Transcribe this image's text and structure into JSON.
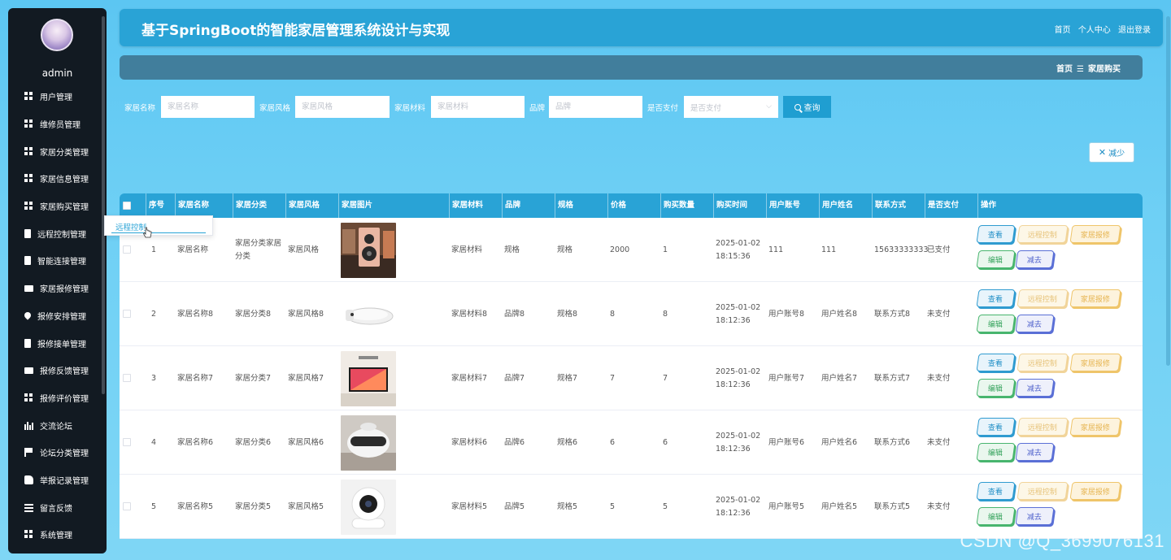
{
  "sidebar": {
    "username": "admin",
    "items": [
      {
        "label": "用户管理",
        "icon": "grid-icon"
      },
      {
        "label": "维修员管理",
        "icon": "grid-icon"
      },
      {
        "label": "家居分类管理",
        "icon": "grid-icon"
      },
      {
        "label": "家居信息管理",
        "icon": "grid-icon"
      },
      {
        "label": "家居购买管理",
        "icon": "grid-icon"
      },
      {
        "label": "远程控制管理",
        "icon": "clipboard-icon"
      },
      {
        "label": "智能连接管理",
        "icon": "clipboard-icon"
      },
      {
        "label": "家居报修管理",
        "icon": "monitor-icon"
      },
      {
        "label": "报修安排管理",
        "icon": "pin-icon"
      },
      {
        "label": "报修接单管理",
        "icon": "clipboard-icon"
      },
      {
        "label": "报修反馈管理",
        "icon": "monitor-icon"
      },
      {
        "label": "报修评价管理",
        "icon": "grid-icon"
      },
      {
        "label": "交流论坛",
        "icon": "chart-icon"
      },
      {
        "label": "论坛分类管理",
        "icon": "flag-icon"
      },
      {
        "label": "举报记录管理",
        "icon": "hand-icon"
      },
      {
        "label": "留言反馈",
        "icon": "lines-icon"
      },
      {
        "label": "系统管理",
        "icon": "grid-icon"
      }
    ]
  },
  "header": {
    "title": "基于SpringBoot的智能家居管理系统设计与实现",
    "links": [
      "首页",
      "个人中心",
      "退出登录"
    ]
  },
  "breadcrumb": {
    "home": "首页",
    "separator": "☰",
    "current": "家居购买"
  },
  "search": {
    "fields": [
      {
        "label": "家居名称",
        "placeholder": "家居名称"
      },
      {
        "label": "家居风格",
        "placeholder": "家居风格"
      },
      {
        "label": "家居材料",
        "placeholder": "家居材料"
      },
      {
        "label": "品牌",
        "placeholder": "品牌"
      }
    ],
    "paid_label": "是否支付",
    "paid_placeholder": "是否支付",
    "button": "查询"
  },
  "reduce_button": "减少",
  "popup": {
    "text": "远程控制"
  },
  "table": {
    "headers": [
      "序号",
      "家居名称",
      "家居分类",
      "家居风格",
      "家居图片",
      "家居材料",
      "品牌",
      "规格",
      "价格",
      "购买数量",
      "购买时间",
      "用户账号",
      "用户姓名",
      "联系方式",
      "是否支付",
      "操作"
    ],
    "rows": [
      {
        "idx": "1",
        "name": "家居名称",
        "category": "家居分类家居分类",
        "style": "家居风格",
        "material": "家居材料",
        "brand": "规格",
        "spec": "规格",
        "price": "2000",
        "qty": "1",
        "time": "2025-01-02 18:15:36",
        "account": "111",
        "uname": "111",
        "contact": "15633333333",
        "paid": "已支付",
        "image": "speaker-icon"
      },
      {
        "idx": "2",
        "name": "家居名称8",
        "category": "家居分类8",
        "style": "家居风格8",
        "material": "家居材料8",
        "brand": "品牌8",
        "spec": "规格8",
        "price": "8",
        "qty": "8",
        "time": "2025-01-02 18:12:36",
        "account": "用户账号8",
        "uname": "用户姓名8",
        "contact": "联系方式8",
        "paid": "未支付",
        "image": "toilet-seat-icon"
      },
      {
        "idx": "3",
        "name": "家居名称7",
        "category": "家居分类7",
        "style": "家居风格7",
        "material": "家居材料7",
        "brand": "品牌7",
        "spec": "规格7",
        "price": "7",
        "qty": "7",
        "time": "2025-01-02 18:12:36",
        "account": "用户账号7",
        "uname": "用户姓名7",
        "contact": "联系方式7",
        "paid": "未支付",
        "image": "tv-icon"
      },
      {
        "idx": "4",
        "name": "家居名称6",
        "category": "家居分类6",
        "style": "家居风格6",
        "material": "家居材料6",
        "brand": "品牌6",
        "spec": "规格6",
        "price": "6",
        "qty": "6",
        "time": "2025-01-02 18:12:36",
        "account": "用户账号6",
        "uname": "用户姓名6",
        "contact": "联系方式6",
        "paid": "未支付",
        "image": "robot-icon"
      },
      {
        "idx": "5",
        "name": "家居名称5",
        "category": "家居分类5",
        "style": "家居风格5",
        "material": "家居材料5",
        "brand": "品牌5",
        "spec": "规格5",
        "price": "5",
        "qty": "5",
        "time": "2025-01-02 18:12:36",
        "account": "用户账号5",
        "uname": "用户姓名5",
        "contact": "联系方式5",
        "paid": "未支付",
        "image": "camera-icon"
      }
    ],
    "actions": {
      "view": "查看",
      "remote": "远程控制",
      "repair": "家居报修",
      "edit": "编辑",
      "minus": "减去"
    }
  },
  "watermark": "CSDN @Q_3699076131"
}
